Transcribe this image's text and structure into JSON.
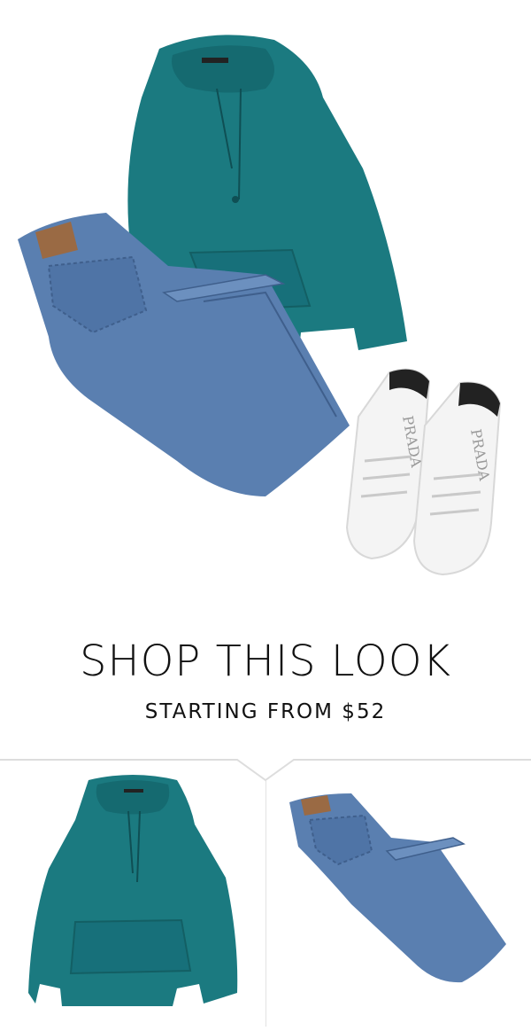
{
  "look": {
    "title": "SHOP THIS LOOK",
    "starting_from": "STARTING FROM $52",
    "shoe_brand": "PRADA"
  },
  "products": [
    {
      "name": "hoodie",
      "color": "#1b7a80"
    },
    {
      "name": "jeans",
      "color": "#5478a8"
    }
  ],
  "colors": {
    "hoodie": "#1b7a80",
    "hoodie_shadow": "#135f64",
    "denim": "#5a7fb0",
    "denim_dark": "#3f5f8c",
    "leather_patch": "#9a6a44",
    "sneaker": "#f4f4f4"
  }
}
